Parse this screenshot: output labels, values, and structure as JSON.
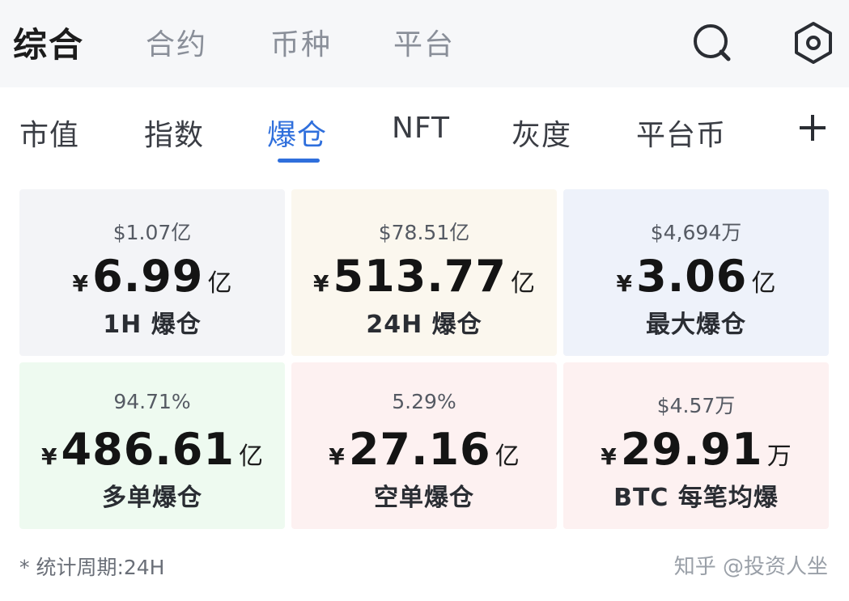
{
  "header": {
    "tabs": [
      {
        "label": "综合"
      },
      {
        "label": "合约"
      },
      {
        "label": "币种"
      },
      {
        "label": "平台"
      }
    ],
    "icons": [
      "search-icon",
      "settings-icon"
    ]
  },
  "subtabs": {
    "items": [
      {
        "label": "市值"
      },
      {
        "label": "指数"
      },
      {
        "label": "爆仓"
      },
      {
        "label": "NFT"
      },
      {
        "label": "灰度"
      },
      {
        "label": "平台币"
      }
    ],
    "add_icon": "plus-icon",
    "active": "爆仓"
  },
  "cards": [
    {
      "sub": "$1.07亿",
      "yen": "¥",
      "value": "6.99",
      "unit": "亿",
      "label": "1H 爆仓",
      "bg": "#f3f4f7"
    },
    {
      "sub": "$78.51亿",
      "yen": "¥",
      "value": "513.77",
      "unit": "亿",
      "label": "24H 爆仓",
      "bg": "#fbf7ee"
    },
    {
      "sub": "$4,694万",
      "yen": "¥",
      "value": "3.06",
      "unit": "亿",
      "label": "最大爆仓",
      "bg": "#eef2fa"
    },
    {
      "sub": "94.71%",
      "yen": "¥",
      "value": "486.61",
      "unit": "亿",
      "label": "多单爆仓",
      "bg": "#eefaf0"
    },
    {
      "sub": "5.29%",
      "yen": "¥",
      "value": "27.16",
      "unit": "亿",
      "label": "空单爆仓",
      "bg": "#fdf1f1"
    },
    {
      "sub": "$4.57万",
      "yen": "¥",
      "value": "29.91",
      "unit": "万",
      "label": "BTC 每笔均爆",
      "bg": "#fdf1f1"
    }
  ],
  "footer": {
    "left": "* 统计周期:24H",
    "right": "知乎 @投资人坐"
  },
  "colors": {
    "accent": "#2f6fdc"
  }
}
